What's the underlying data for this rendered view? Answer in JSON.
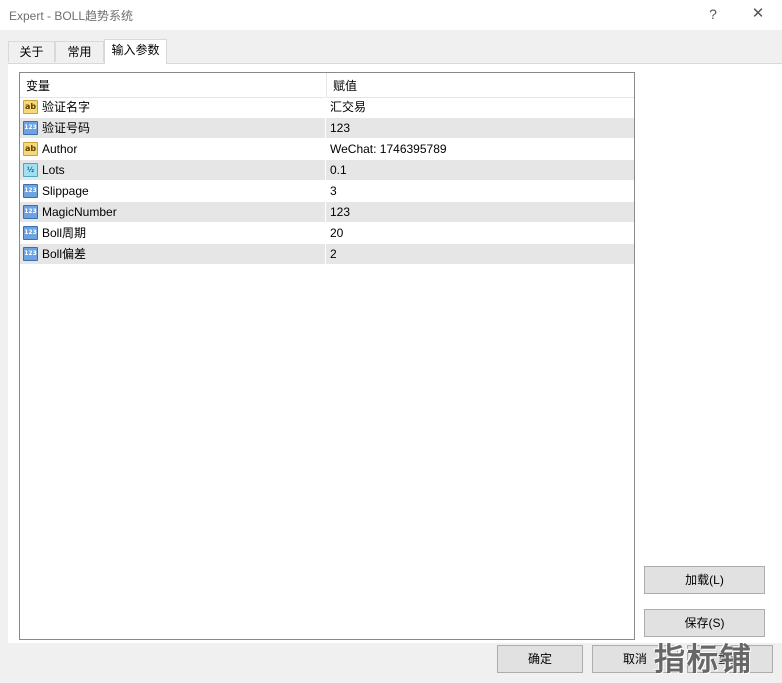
{
  "window": {
    "title": "Expert - BOLL趋势系统",
    "help_glyph": "?",
    "close_glyph": "✕"
  },
  "tabs": [
    {
      "label": "关于",
      "active": false
    },
    {
      "label": "常用",
      "active": false
    },
    {
      "label": "输入参数",
      "active": true
    }
  ],
  "grid": {
    "col_variable": "变量",
    "col_value": "赋值",
    "rows": [
      {
        "type_icon": "string-ab-icon",
        "icon_text": "ab",
        "name": "验证名字",
        "value": "汇交易"
      },
      {
        "type_icon": "integer-123-icon",
        "icon_text": "123",
        "name": "验证号码",
        "value": "123"
      },
      {
        "type_icon": "string-ab-icon",
        "icon_text": "ab",
        "name": "Author",
        "value": "WeChat:  1746395789"
      },
      {
        "type_icon": "double-fraction-icon",
        "icon_text": "½",
        "name": "Lots",
        "value": "0.1"
      },
      {
        "type_icon": "integer-123-icon",
        "icon_text": "123",
        "name": "Slippage",
        "value": "3"
      },
      {
        "type_icon": "integer-123-icon",
        "icon_text": "123",
        "name": "MagicNumber",
        "value": "123"
      },
      {
        "type_icon": "integer-123-icon",
        "icon_text": "123",
        "name": "Boll周期",
        "value": "20"
      },
      {
        "type_icon": "integer-123-icon",
        "icon_text": "123",
        "name": "Boll偏差",
        "value": "2"
      }
    ]
  },
  "buttons": {
    "load": "加载(L)",
    "save": "保存(S)",
    "ok": "确定",
    "cancel": "取消",
    "reset": "重置"
  },
  "watermark": "指标铺",
  "colors": {
    "row_alt": "#e6e6e6",
    "icon_string": "#f6d77a",
    "icon_integer": "#6fa3e0",
    "icon_double": "#9fe0f2"
  }
}
